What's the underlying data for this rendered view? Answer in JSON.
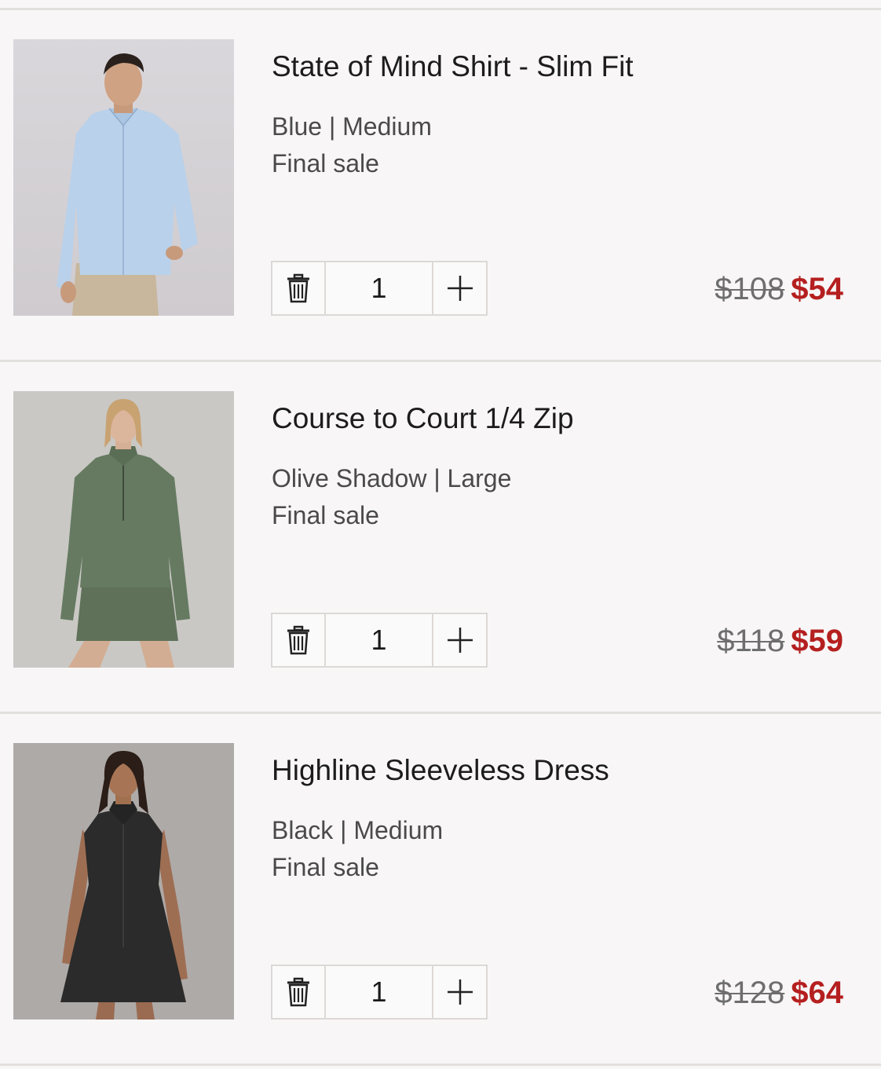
{
  "colors": {
    "background": "#f8f6f6",
    "divider": "#e3dfdd",
    "sale_price": "#b51f1f",
    "original_price": "#6e6e6e"
  },
  "items": [
    {
      "title": "State of Mind Shirt - Slim Fit",
      "variant": "Blue | Medium",
      "note": "Final sale",
      "quantity": "1",
      "original_price": "$108",
      "sale_price": "$54",
      "image": "man in light blue button-up shirt and khaki pants",
      "delete_icon": "trash-icon",
      "plus_icon": "plus-icon"
    },
    {
      "title": "Course to Court 1/4 Zip",
      "variant": "Olive Shadow | Large",
      "note": "Final sale",
      "quantity": "1",
      "original_price": "$118",
      "sale_price": "$59",
      "image": "woman in olive quarter-zip top and olive skirt",
      "delete_icon": "trash-icon",
      "plus_icon": "plus-icon"
    },
    {
      "title": "Highline Sleeveless Dress",
      "variant": "Black | Medium",
      "note": "Final sale",
      "quantity": "1",
      "original_price": "$128",
      "sale_price": "$64",
      "image": "woman in black sleeveless collared dress",
      "delete_icon": "trash-icon",
      "plus_icon": "plus-icon"
    }
  ]
}
